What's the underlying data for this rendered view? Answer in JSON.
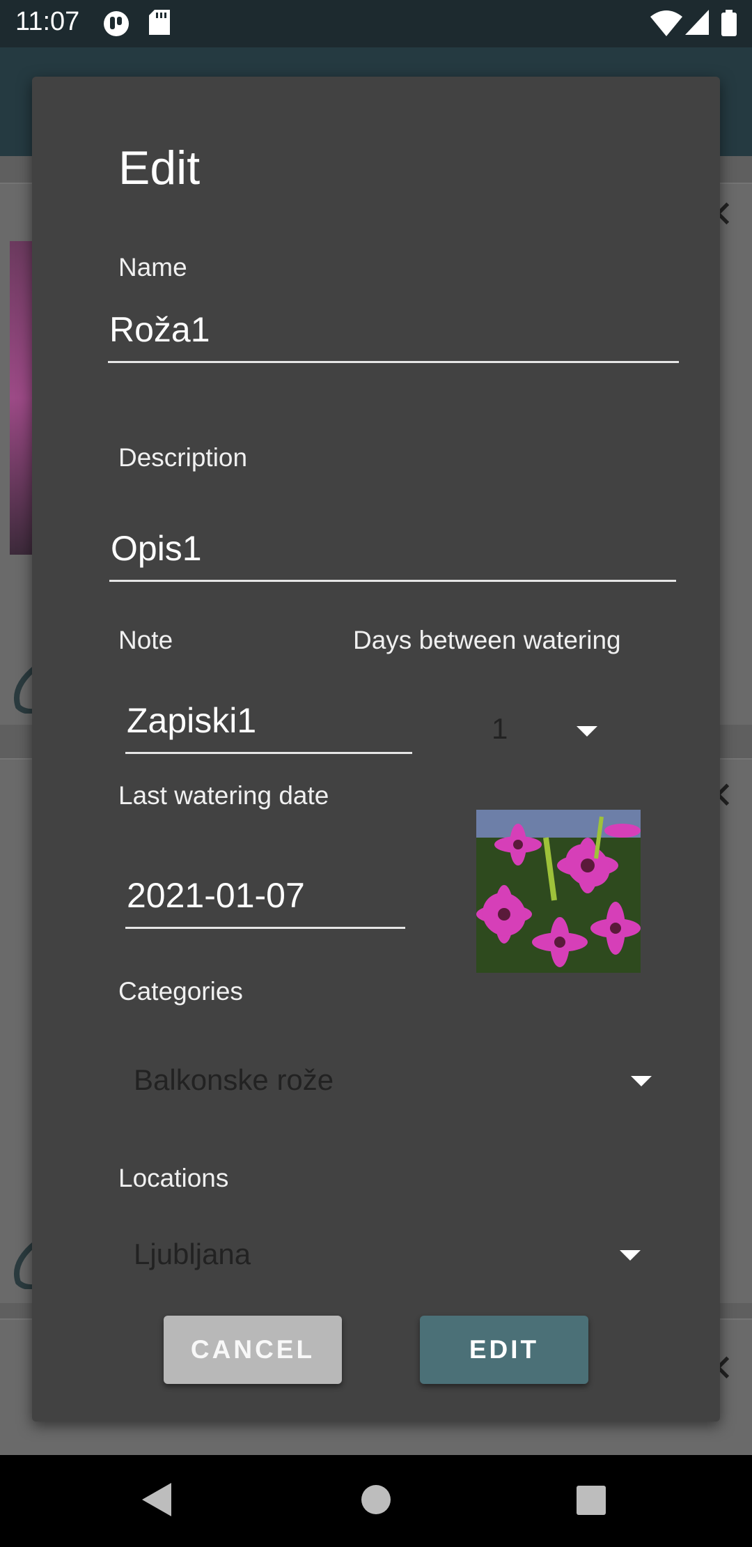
{
  "status_bar": {
    "time": "11:07"
  },
  "dialog": {
    "title": "Edit",
    "name": {
      "label": "Name",
      "value": "Roža1"
    },
    "description": {
      "label": "Description",
      "value": "Opis1"
    },
    "note": {
      "label": "Note",
      "value": "Zapiski1"
    },
    "days": {
      "label": "Days between watering",
      "value": "1"
    },
    "last_watering": {
      "label": "Last watering date",
      "value": "2021-01-07"
    },
    "categories": {
      "label": "Categories",
      "value": "Balkonske rože"
    },
    "locations": {
      "label": "Locations",
      "value": "Ljubljana"
    },
    "cancel_label": "CANCEL",
    "edit_label": "EDIT"
  },
  "colors": {
    "dialog_bg": "#424242",
    "edit_button": "#4b7077",
    "cancel_button": "#b8b8b8",
    "status_bar": "#1d2a2f",
    "app_bar": "#253a41"
  },
  "icons": [
    "app-status-icon",
    "sd-card-icon",
    "wifi-icon",
    "signal-icon",
    "battery-icon",
    "back-icon",
    "home-icon",
    "recents-icon",
    "dropdown-arrow-icon",
    "close-icon",
    "plant-photo"
  ]
}
